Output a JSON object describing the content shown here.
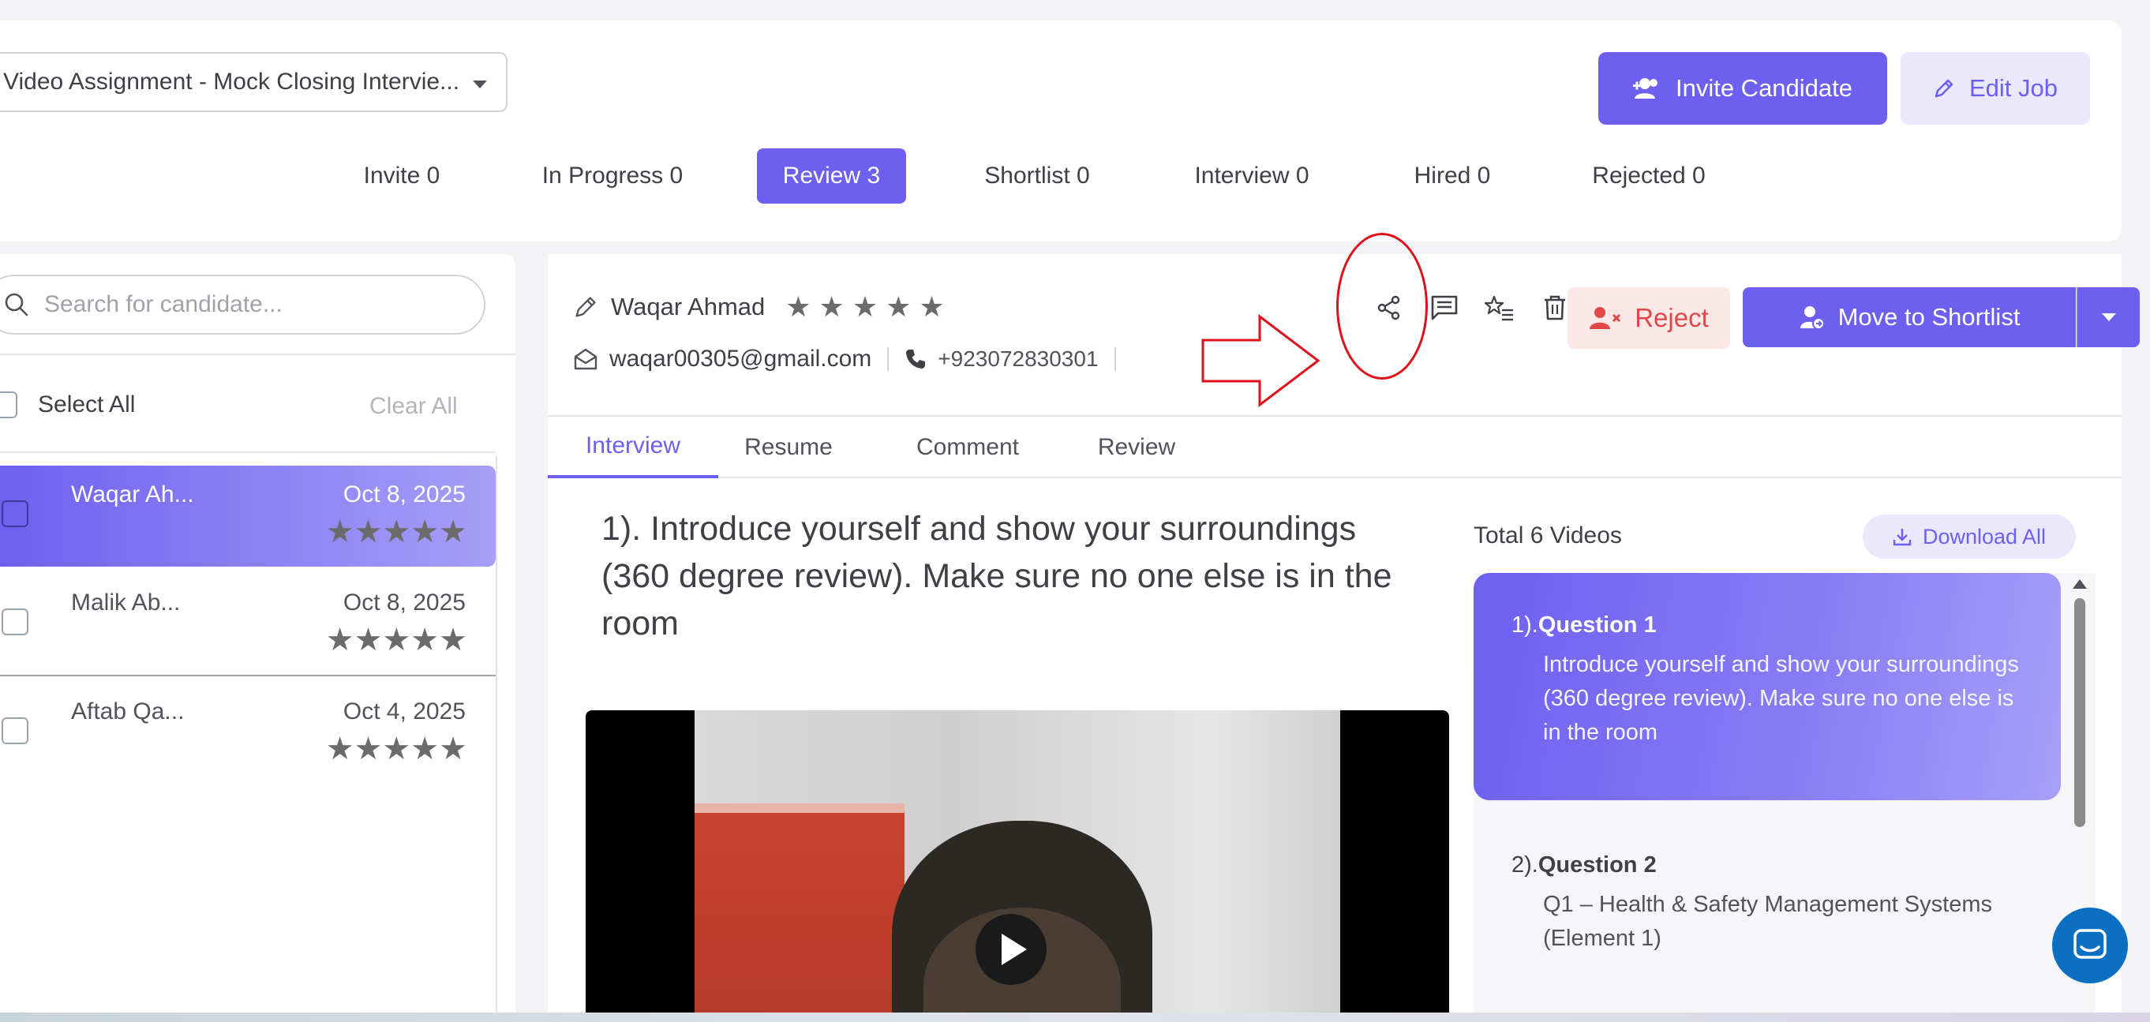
{
  "header": {
    "job_select_value": "Video Assignment - Mock Closing Intervie...",
    "invite_button_label": "Invite Candidate",
    "edit_button_label": "Edit Job"
  },
  "stage_tabs": [
    {
      "label": "Invite 0"
    },
    {
      "label": "In Progress 0"
    },
    {
      "label": "Review 3",
      "active": true
    },
    {
      "label": "Shortlist 0"
    },
    {
      "label": "Interview 0"
    },
    {
      "label": "Hired 0"
    },
    {
      "label": "Rejected 0"
    }
  ],
  "sidebar": {
    "search_placeholder": "Search for candidate...",
    "select_all_label": "Select All",
    "clear_all_label": "Clear All",
    "candidates": [
      {
        "name": "Waqar Ah...",
        "date": "Oct 8, 2025",
        "stars": "★★★★★",
        "active": true
      },
      {
        "name": "Malik Ab...",
        "date": "Oct 8, 2025",
        "stars": "★★★★★"
      },
      {
        "name": "Aftab Qa...",
        "date": "Oct 4, 2025",
        "stars": "★★★★★"
      }
    ]
  },
  "candidate": {
    "name": "Waqar Ahmad",
    "rating_stars": "★ ★ ★ ★ ★",
    "email": "waqar00305@gmail.com",
    "phone": "+923072830301"
  },
  "actions": {
    "reject_label": "Reject",
    "shortlist_label": "Move to Shortlist"
  },
  "content_tabs": [
    {
      "label": "Interview",
      "active": true
    },
    {
      "label": "Resume"
    },
    {
      "label": "Comment"
    },
    {
      "label": "Review"
    }
  ],
  "interview": {
    "question_title": "1). Introduce yourself and show your surroundings (360 degree review). Make sure no one else is in the room",
    "total_videos_label": "Total 6 Videos",
    "download_all_label": "Download All",
    "questions": [
      {
        "number": "1).",
        "title": "Question 1",
        "text": "Introduce yourself and show your surroundings (360 degree review). Make sure no one else is in the room"
      },
      {
        "number": "2).",
        "title": "Question 2",
        "text": "Q1 – Health & Safety Management Systems (Element 1)"
      }
    ]
  },
  "colors": {
    "accent": "#6d5ff0",
    "accent_light": "#ebe8fd",
    "reject_text": "#e04848",
    "reject_bg": "#fde8e8",
    "annotation_red": "#e0101a"
  }
}
